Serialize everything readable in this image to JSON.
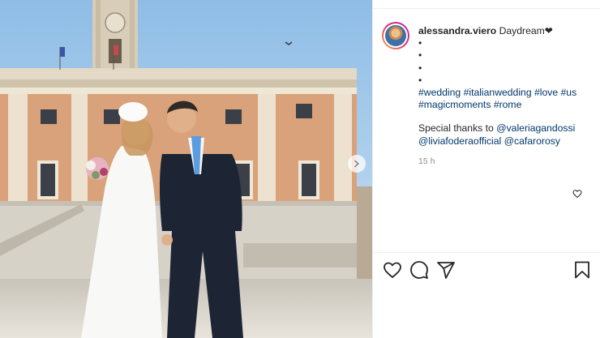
{
  "post": {
    "username": "alessandra.viero",
    "caption_text": "Daydream❤",
    "dots": [
      "•",
      "•",
      "•",
      "•"
    ],
    "hashtags_line1": [
      "#wedding",
      "#italianwedding",
      "#love",
      "#us"
    ],
    "hashtags_line2": [
      "#magicmoments",
      "#rome"
    ],
    "thanks_text": "Special thanks to",
    "mentions": [
      "@valeriagandossi",
      "@liviafoderaofficial",
      "@cafarorosy"
    ],
    "timestamp": "15 h"
  },
  "icons": {
    "like": "heart-icon",
    "comment": "comment-icon",
    "share": "share-icon",
    "save": "bookmark-icon",
    "next": "chevron-right-icon"
  },
  "colors": {
    "link": "#00376b",
    "text": "#262626",
    "muted": "#8e8e8e",
    "sky": "#9ec5e8",
    "building": "#d9a27a"
  }
}
